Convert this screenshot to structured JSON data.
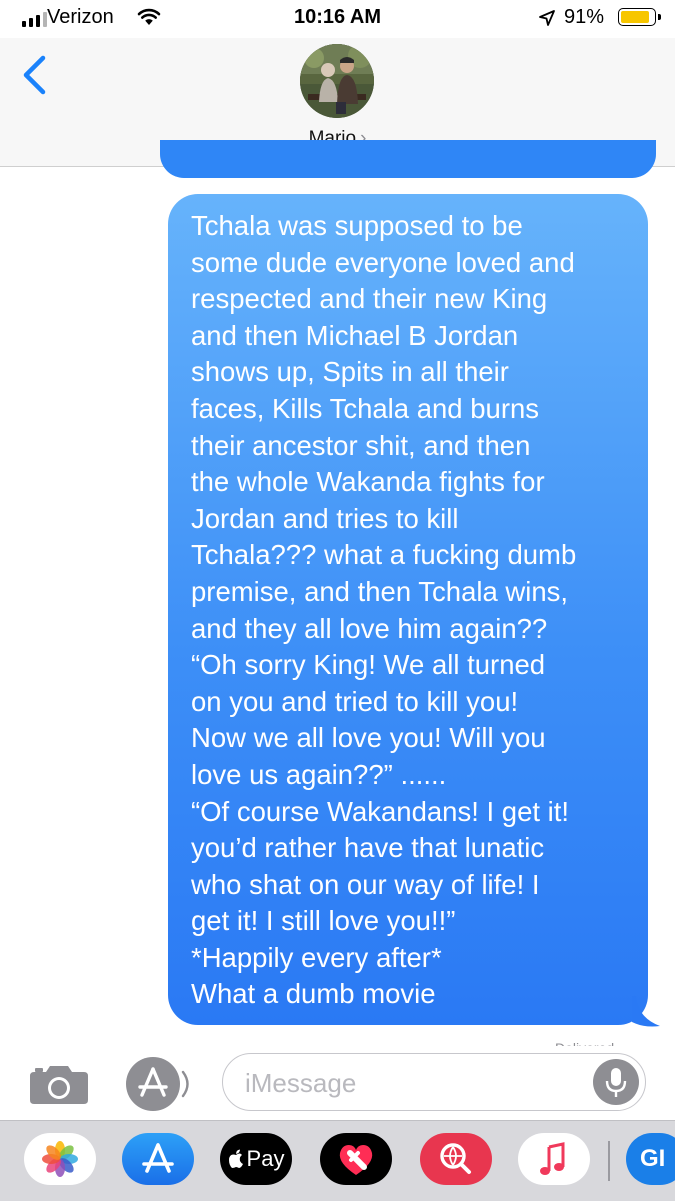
{
  "status_bar": {
    "carrier": "Verizon",
    "time": "10:16 AM",
    "battery_percent": "91%",
    "battery_level": 0.91,
    "signal_bars": 4,
    "signal_bars_filled": 3
  },
  "header": {
    "contact_name": "Mario",
    "chevron": "›"
  },
  "conversation": {
    "messages": [
      {
        "sender": "me",
        "lines": [
          "Tchala was supposed to be",
          "some dude everyone loved and",
          "respected and their new King",
          "and then Michael B Jordan",
          "shows up, Spits in all their",
          "faces, Kills Tchala and burns",
          "their ancestor shit, and then",
          "the whole Wakanda fights for",
          "Jordan and tries to kill",
          "Tchala??? what a fucking dumb",
          "premise, and then Tchala wins,",
          "and they all love him again??",
          "“Oh sorry King! We all turned",
          "on you and tried to kill you!",
          "Now we all love you! Will you",
          "love us again??” ......",
          "“Of course Wakandans! I get it!",
          "you’d rather have that lunatic",
          "who shat on our way of life! I",
          "get it! I still love you!!”",
          "*Happily every after*",
          "What a dumb movie"
        ]
      }
    ],
    "receipt": "Delivered"
  },
  "input": {
    "placeholder": "iMessage",
    "value": ""
  },
  "app_drawer": {
    "pay_label": "Pay",
    "gif_label": "GI"
  },
  "colors": {
    "bubble_top": "#66b3fb",
    "bubble_bottom": "#2a79f4",
    "ios_blue": "#1a82fb",
    "battery_yellow": "#f7c600",
    "icon_gray": "#8e8e93"
  }
}
